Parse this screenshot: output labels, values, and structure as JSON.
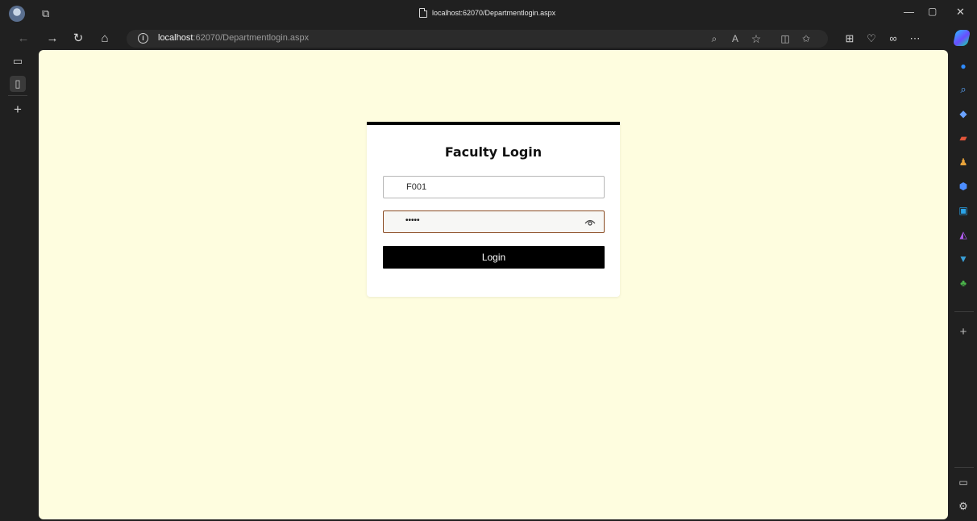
{
  "window": {
    "title": "localhost:62070/Departmentlogin.aspx",
    "controls": {
      "minimize": "—",
      "restore": "▢",
      "close": "✕"
    }
  },
  "toolbar": {
    "url_host": "localhost",
    "url_rest": ":62070/Departmentlogin.aspx",
    "icons": [
      "back-icon",
      "forward-icon",
      "refresh-icon",
      "home-icon",
      "site-info-icon",
      "read-aloud-icon",
      "text-size-icon",
      "favorite-star-icon",
      "split-screen-icon",
      "favorites-icon",
      "collections-icon",
      "browser-essentials-icon",
      "profile-sync-icon",
      "more-icon",
      "copilot-icon"
    ]
  },
  "left_sidebar": {
    "icons": [
      "tab-actions-icon",
      "page-icon",
      "new-tab-plus-icon"
    ]
  },
  "login_form": {
    "title": "Faculty Login",
    "username_value": "F001",
    "password_mask": "•••••",
    "login_label": "Login"
  },
  "right_sidebar": {
    "icons": [
      "notifications-icon",
      "search-icon",
      "shopping-tag-icon",
      "tools-briefcase-icon",
      "people-icon",
      "m365-icon",
      "outlook-icon",
      "designer-icon",
      "drop-icon",
      "tree-icon",
      "add-icon",
      "sidebar-toggle-icon",
      "settings-gear-icon"
    ]
  },
  "colors": {
    "page_background": "#fefddf",
    "card_background": "#ffffff",
    "card_top_border": "#000000",
    "login_button": "#000000",
    "password_border": "#8a4b22",
    "browser_chrome": "#202020"
  }
}
